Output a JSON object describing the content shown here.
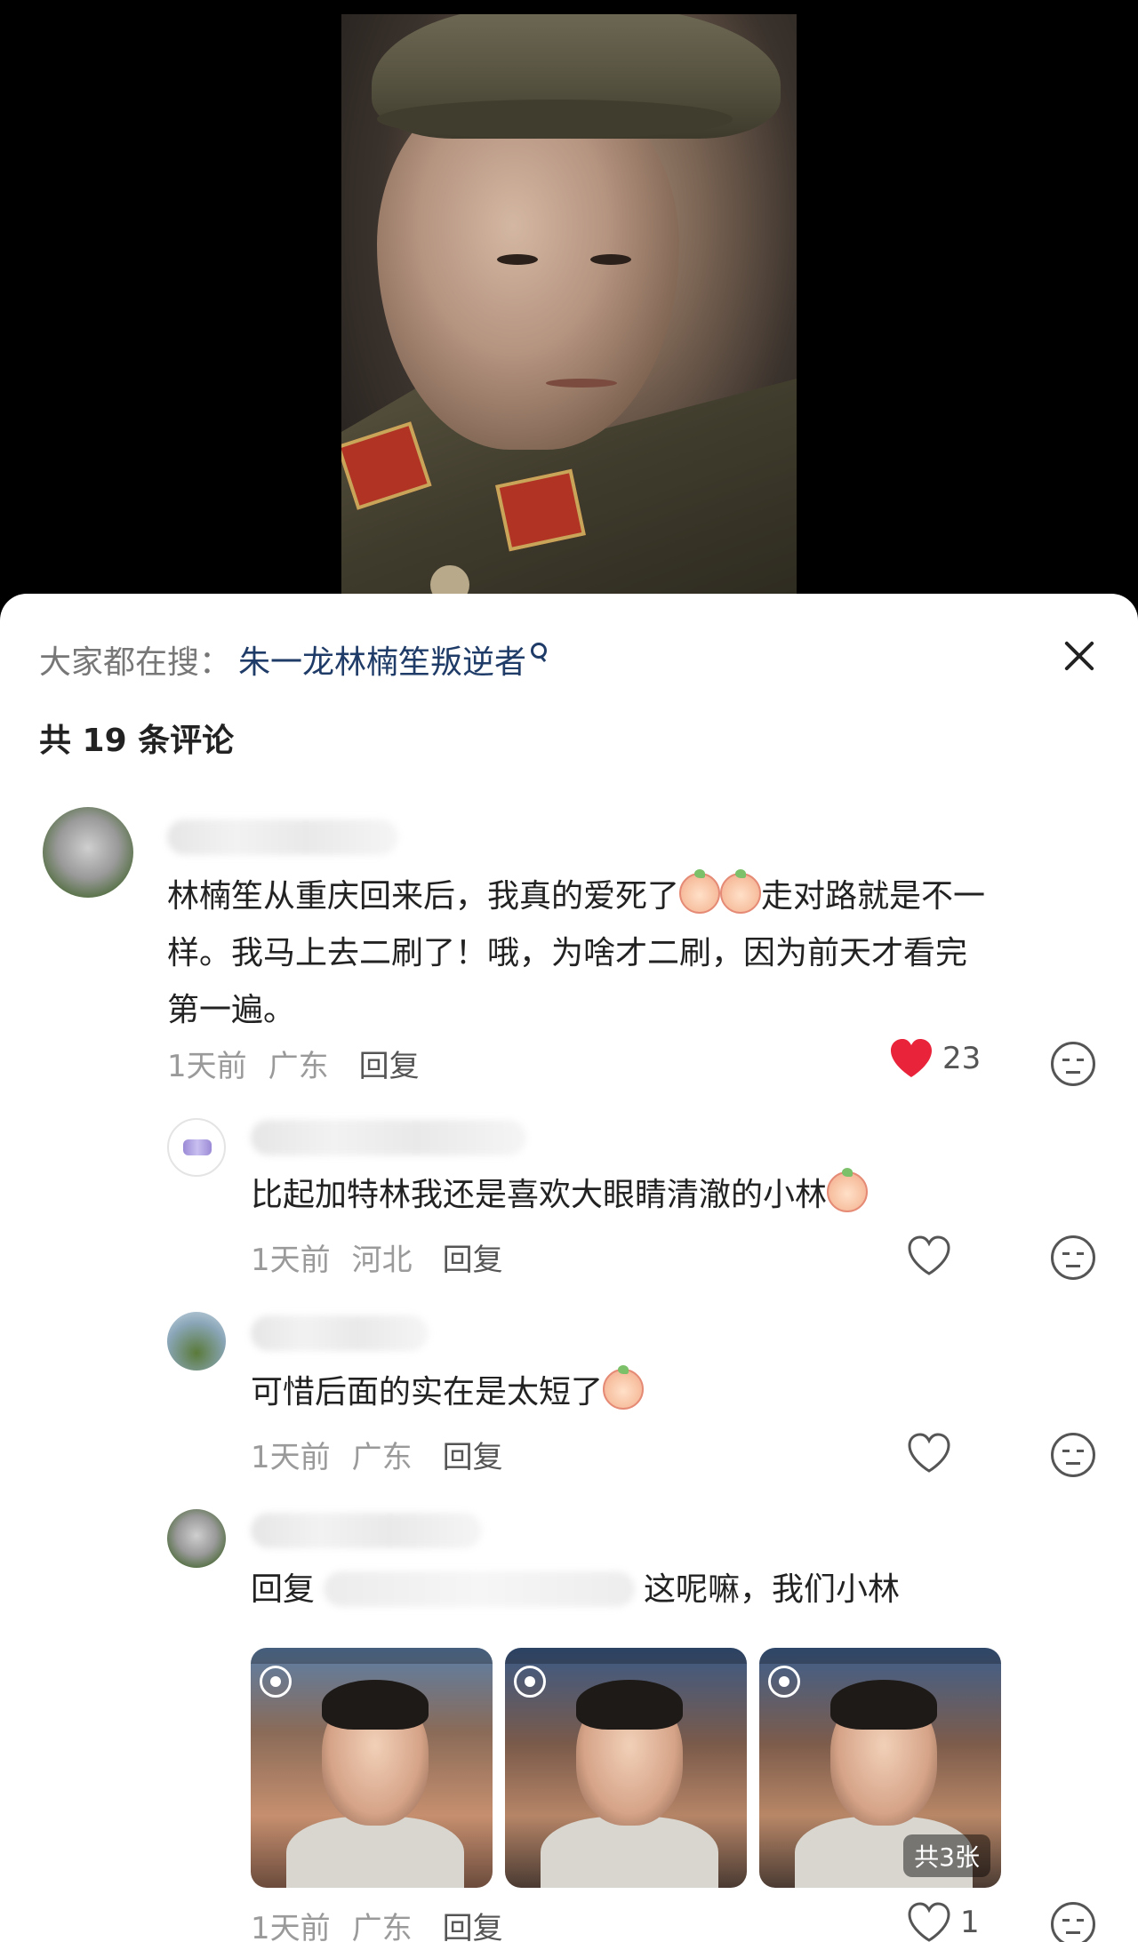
{
  "search": {
    "prefix": "大家都在搜：",
    "term": "朱一龙林楠笙叛逆者"
  },
  "comments_count": "共 19 条评论",
  "comments": [
    {
      "text_a": "林楠笙从重庆回来后，我真的爱死了",
      "text_b": "走对路就是不一",
      "text_c": "样。我马上去二刷了！哦，为啥才二刷，因为前天才看完",
      "text_d": "第一遍。",
      "time": "1天前",
      "location": "广东",
      "reply": "回复",
      "likes": "23",
      "liked": true
    }
  ],
  "replies": [
    {
      "text": "比起加特林我还是喜欢大眼睛清澈的小林",
      "time": "1天前",
      "location": "河北",
      "reply": "回复"
    },
    {
      "text": "可惜后面的实在是太短了",
      "time": "1天前",
      "location": "广东",
      "reply": "回复"
    },
    {
      "prefix": "回复",
      "text": "这呢嘛，我们小林",
      "time": "1天前",
      "location": "广东",
      "reply": "回复",
      "likes": "1",
      "image_count": "共3张"
    }
  ],
  "colors": {
    "heart_active": "#e8233a",
    "search_term": "#1f3b67"
  }
}
